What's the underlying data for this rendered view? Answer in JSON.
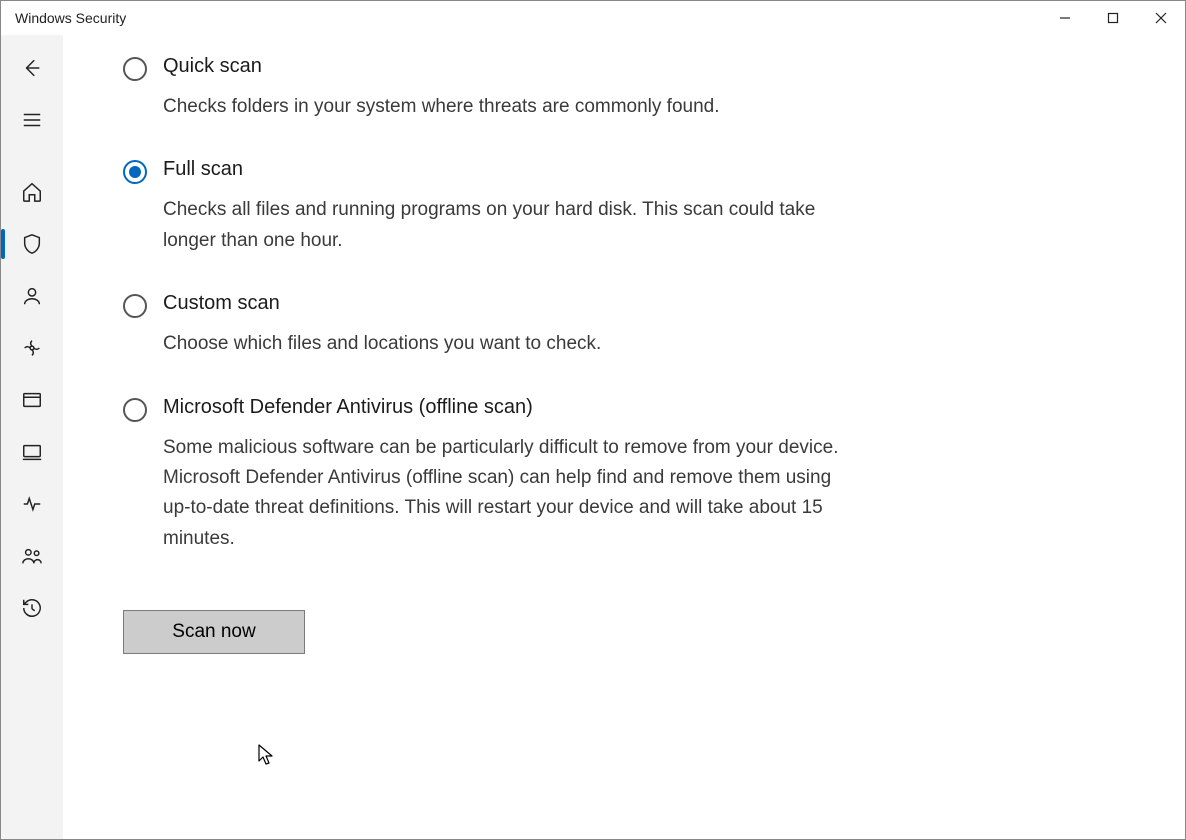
{
  "window": {
    "title": "Windows Security"
  },
  "sidebar": {
    "items": [
      {
        "icon": "back"
      },
      {
        "icon": "menu"
      },
      {
        "icon": "home"
      },
      {
        "icon": "shield",
        "active": true
      },
      {
        "icon": "account"
      },
      {
        "icon": "firewall"
      },
      {
        "icon": "app-browser"
      },
      {
        "icon": "device-security"
      },
      {
        "icon": "device-performance"
      },
      {
        "icon": "family"
      },
      {
        "icon": "protection-history"
      }
    ]
  },
  "options": [
    {
      "title": "Quick scan",
      "desc": "Checks folders in your system where threats are commonly found.",
      "selected": false
    },
    {
      "title": "Full scan",
      "desc": "Checks all files and running programs on your hard disk. This scan could take longer than one hour.",
      "selected": true
    },
    {
      "title": "Custom scan",
      "desc": "Choose which files and locations you want to check.",
      "selected": false
    },
    {
      "title": "Microsoft Defender Antivirus (offline scan)",
      "desc": "Some malicious software can be particularly difficult to remove from your device. Microsoft Defender Antivirus (offline scan) can help find and remove them using up-to-date threat definitions. This will restart your device and will take about 15 minutes.",
      "selected": false
    }
  ],
  "actions": {
    "scan_now_label": "Scan now"
  }
}
